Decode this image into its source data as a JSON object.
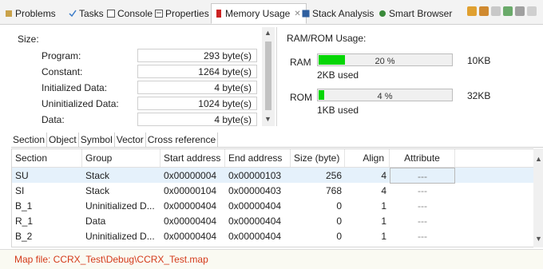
{
  "tabs": [
    {
      "label": "Problems",
      "icon": "problems-icon",
      "active": false
    },
    {
      "label": "Tasks",
      "icon": "tasks-icon",
      "active": false
    },
    {
      "label": "Console",
      "icon": "console-icon",
      "active": false
    },
    {
      "label": "Properties",
      "icon": "properties-icon",
      "active": false
    },
    {
      "label": "Memory Usage",
      "icon": "memory-usage-icon",
      "active": true,
      "close": "✕"
    },
    {
      "label": "Stack Analysis",
      "icon": "stack-analysis-icon",
      "active": false
    },
    {
      "label": "Smart Browser",
      "icon": "smart-browser-icon",
      "active": false
    }
  ],
  "size": {
    "title": "Size:",
    "rows": [
      {
        "label": "Program:",
        "value": "293 byte(s)"
      },
      {
        "label": "Constant:",
        "value": "1264 byte(s)"
      },
      {
        "label": "Initialized Data:",
        "value": "4 byte(s)"
      },
      {
        "label": "Uninitialized Data:",
        "value": "1024 byte(s)"
      },
      {
        "label": "Data:",
        "value": "4 byte(s)"
      }
    ]
  },
  "usage": {
    "title": "RAM/ROM Usage:",
    "rows": [
      {
        "label": "RAM",
        "percent_text": "20 %",
        "fill_fraction": 0.2,
        "used": "2KB used",
        "total": "10KB"
      },
      {
        "label": "ROM",
        "percent_text": "4 %",
        "fill_fraction": 0.04,
        "used": "1KB used",
        "total": "32KB"
      }
    ],
    "fill_color": "#06d606"
  },
  "inner_tabs": [
    "Section",
    "Object",
    "Symbol",
    "Vector",
    "Cross reference"
  ],
  "table": {
    "headers": [
      "Section",
      "Group",
      "Start address",
      "End address",
      "Size (byte)",
      "Align",
      "Attribute"
    ],
    "rows": [
      [
        "SU",
        "Stack",
        "0x00000004",
        "0x00000103",
        "256",
        "4",
        "---"
      ],
      [
        "SI",
        "Stack",
        "0x00000104",
        "0x00000403",
        "768",
        "4",
        "---"
      ],
      [
        "B_1",
        "Uninitialized D...",
        "0x00000404",
        "0x00000404",
        "0",
        "1",
        "---"
      ],
      [
        "R_1",
        "Data",
        "0x00000404",
        "0x00000404",
        "0",
        "1",
        "---"
      ],
      [
        "B_2",
        "Uninitialized D...",
        "0x00000404",
        "0x00000404",
        "0",
        "1",
        "---"
      ]
    ]
  },
  "map_file": "Map file: CCRX_Test\\Debug\\CCRX_Test.map",
  "colors": {
    "accent_red": "#d43a1a",
    "selection": "#e5f1fb"
  }
}
